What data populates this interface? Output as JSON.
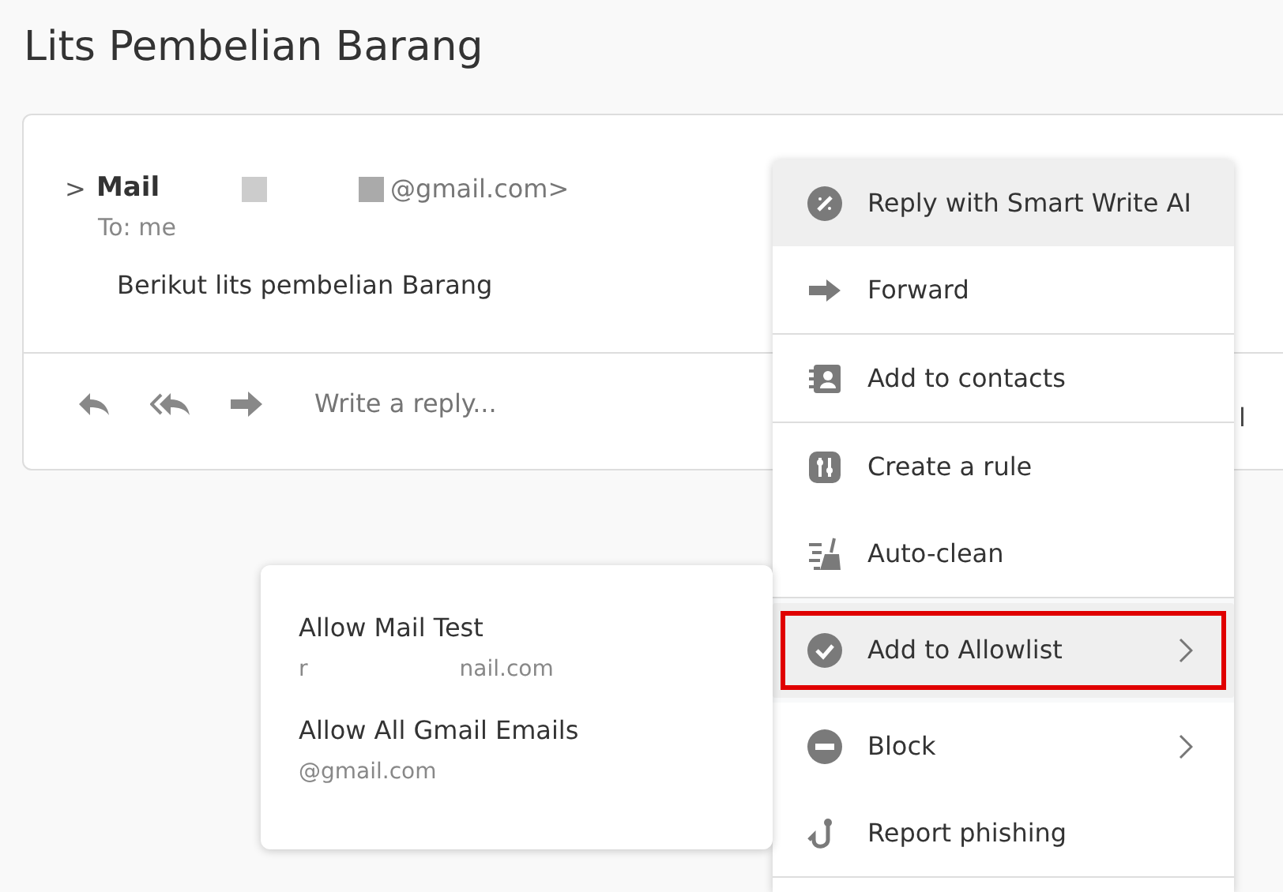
{
  "page_title": "Lits Pembelian Barang",
  "message": {
    "expand_glyph": ">",
    "sender_name": "Mail",
    "sender_address": "@gmail.com>",
    "recipient": "To: me",
    "body": "Berikut lits pembelian Barang"
  },
  "reply_bar": {
    "placeholder": "Write a reply...",
    "trailing_text": "l"
  },
  "context_menu": {
    "items": [
      {
        "label": "Reply with Smart Write AI",
        "highlighted": true,
        "outlined": false,
        "has_submenu": false,
        "divider_after": false
      },
      {
        "label": "Forward",
        "highlighted": false,
        "outlined": false,
        "has_submenu": false,
        "divider_after": true
      },
      {
        "label": "Add to contacts",
        "highlighted": false,
        "outlined": false,
        "has_submenu": false,
        "divider_after": true
      },
      {
        "label": "Create a rule",
        "highlighted": false,
        "outlined": false,
        "has_submenu": false,
        "divider_after": false
      },
      {
        "label": "Auto-clean",
        "highlighted": false,
        "outlined": false,
        "has_submenu": false,
        "divider_after": true
      },
      {
        "label": "Add to Allowlist",
        "highlighted": true,
        "outlined": true,
        "has_submenu": true,
        "divider_after": false
      },
      {
        "label": "Block",
        "highlighted": false,
        "outlined": false,
        "has_submenu": true,
        "divider_after": false
      },
      {
        "label": "Report phishing",
        "highlighted": false,
        "outlined": false,
        "has_submenu": false,
        "divider_after": true
      }
    ]
  },
  "submenu": {
    "items": [
      {
        "label": "Allow Mail Test",
        "detail_parts": [
          "r",
          "nail.com"
        ]
      },
      {
        "label": "Allow All Gmail Emails",
        "detail_parts": [
          "@gmail.com"
        ]
      }
    ]
  }
}
